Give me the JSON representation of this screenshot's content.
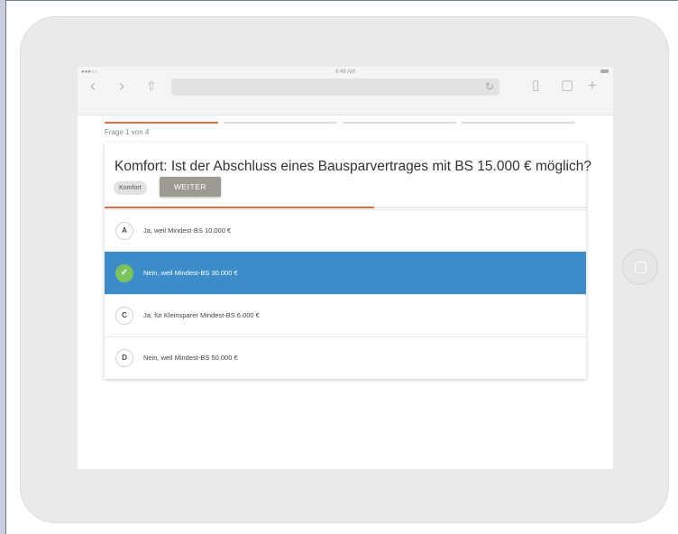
{
  "browser": {
    "status_dots": "●●●○○",
    "time": "9:49 AM",
    "icons": [
      "back-icon",
      "forward-icon",
      "share-icon",
      "reload-icon",
      "bookmarks-icon",
      "tabs-icon",
      "new-tab-icon"
    ],
    "back_glyph": "‹",
    "forward_glyph": "›",
    "share_glyph": "⇧",
    "reload_glyph": "↻",
    "bookmarks_glyph": "▯",
    "tabs_glyph": "▢",
    "new_tab_glyph": "+"
  },
  "quiz": {
    "question_count": "Frage 1 von 4",
    "progress": {
      "total": 4,
      "current": 1
    },
    "question": "Komfort: Ist der Abschluss eines Bausparvertrages mit BS 15.000 € möglich?",
    "category": "Komfort",
    "next_label": "WEITER",
    "timer_fraction": 0.56,
    "answers": [
      {
        "letter": "A",
        "text": "Ja, weil Mindest-BS 10.000 €",
        "selected": false
      },
      {
        "letter": "✓",
        "text": "Nein, weil Mindest-BS 30.000 €",
        "selected": true
      },
      {
        "letter": "C",
        "text": "Ja, für Kleinsparer Mindest-BS 6.000 €",
        "selected": false
      },
      {
        "letter": "D",
        "text": "Nein, weil Mindest-BS 50.000 €",
        "selected": false
      }
    ]
  },
  "colors": {
    "accent": "#e07046",
    "selected": "#3b8cc9",
    "check": "#7cc35b",
    "button": "#9d9a91"
  }
}
